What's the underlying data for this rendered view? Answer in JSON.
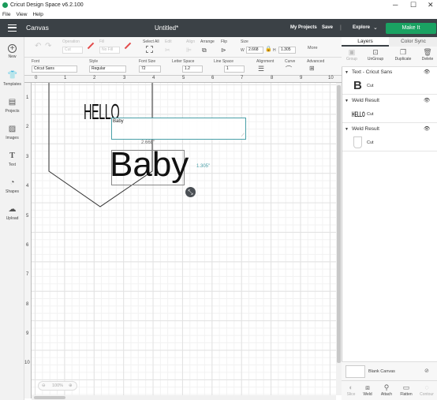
{
  "app": {
    "title": "Cricut Design Space  v6.2.100",
    "minimize": "─",
    "maximize": "☐",
    "close": "✕"
  },
  "menu": [
    "File",
    "View",
    "Help"
  ],
  "header": {
    "section": "Canvas",
    "doc_title": "Untitled*",
    "my_projects": "My Projects",
    "save": "Save",
    "explore": "Explore",
    "make_it": "Make It"
  },
  "edit1": {
    "operation": "Operation",
    "operation_value": "Cut",
    "fill": "Fill",
    "fill_value": "No Fill",
    "select_all": "Select All",
    "edit": "Edit",
    "align": "Align",
    "arrange": "Arrange",
    "flip": "Flip",
    "size": "Size",
    "w_label": "W",
    "w_value": "2.668",
    "h_label": "H",
    "h_value": "1.305",
    "more": "More"
  },
  "edit2": {
    "font": "Font",
    "font_value": "Cricut Sans",
    "style": "Style",
    "style_value": "Regular",
    "font_size": "Font Size",
    "font_size_value": "72",
    "letter_space": "Letter Space",
    "letter_space_value": "1.2",
    "line_space": "Line Space",
    "line_space_value": "1",
    "alignment": "Alignment",
    "curve": "Curve",
    "advanced": "Advanced"
  },
  "sidebar": [
    {
      "label": "New",
      "icon": "plus-icon"
    },
    {
      "label": "Templates",
      "icon": "shirt-icon"
    },
    {
      "label": "Projects",
      "icon": "projects-icon"
    },
    {
      "label": "Images",
      "icon": "image-icon"
    },
    {
      "label": "Text",
      "icon": "text-icon"
    },
    {
      "label": "Shapes",
      "icon": "shapes-icon"
    },
    {
      "label": "Upload",
      "icon": "upload-icon"
    }
  ],
  "ruler": {
    "top": [
      "0",
      "1",
      "2",
      "3",
      "4",
      "5",
      "6",
      "7",
      "8",
      "9",
      "10"
    ],
    "left": [
      "1",
      "2",
      "3",
      "4",
      "5",
      "6",
      "7",
      "8",
      "9",
      "10"
    ]
  },
  "canvas": {
    "hello_text": "HELLO",
    "baby_text": "Baby",
    "edit_value": "Baby",
    "width_dim": "2.668\"",
    "height_dim": "1.305\"",
    "zoom": "100%"
  },
  "panel": {
    "tabs": [
      "Layers",
      "Color Sync"
    ],
    "tools": [
      "Group",
      "UnGroup",
      "Duplicate",
      "Delete"
    ],
    "groups": [
      {
        "title": "Text - Cricut Sans",
        "row_label": "Cut",
        "thumb": "B"
      },
      {
        "title": "Weld Result",
        "row_label": "Cut",
        "thumb": "HELLO"
      },
      {
        "title": "Weld Result",
        "row_label": "Cut",
        "thumb": ""
      }
    ],
    "blank_canvas": "Blank Canvas",
    "bottom_tools": [
      "Slice",
      "Weld",
      "Attach",
      "Flatten",
      "Contour"
    ]
  },
  "colors": {
    "header_bg": "#3b4146",
    "make_it": "#1aa262",
    "accent_teal": "#4aa0a8"
  }
}
